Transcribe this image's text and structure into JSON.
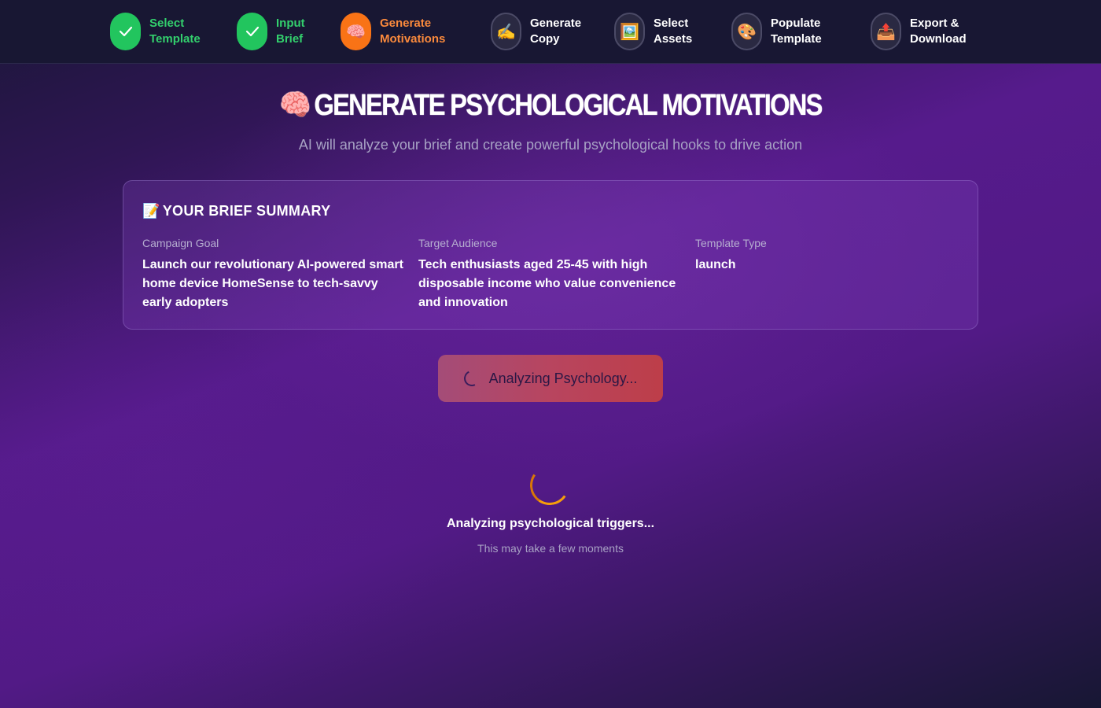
{
  "stepper": {
    "steps": [
      {
        "line1": "Select",
        "line2": "Template",
        "icon": "check-icon",
        "status": "done"
      },
      {
        "line1": "Input",
        "line2": "Brief",
        "icon": "check-icon",
        "status": "done"
      },
      {
        "line1": "Generate",
        "line2": "Motivations",
        "icon": "🧠",
        "status": "active"
      },
      {
        "line1": "Generate",
        "line2": "Copy",
        "icon": "✍️",
        "status": "pending"
      },
      {
        "line1": "Select",
        "line2": "Assets",
        "icon": "🖼️",
        "status": "pending"
      },
      {
        "line1": "Populate",
        "line2": "Template",
        "icon": "🎨",
        "status": "pending"
      },
      {
        "line1": "Export &",
        "line2": "Download",
        "icon": "📤",
        "status": "pending"
      }
    ]
  },
  "header": {
    "icon": "🧠",
    "title": "GENERATE PSYCHOLOGICAL MOTIVATIONS",
    "subtitle": "AI will analyze your brief and create powerful psychological hooks to drive action"
  },
  "brief": {
    "icon": "📝",
    "title": "YOUR BRIEF SUMMARY",
    "fields": [
      {
        "label": "Campaign Goal",
        "value": "Launch our revolutionary AI-powered smart home device HomeSense to tech-savvy early adopters"
      },
      {
        "label": "Target Audience",
        "value": "Tech enthusiasts aged 25-45 with high disposable income who value convenience and innovation"
      },
      {
        "label": "Template Type",
        "value": "launch"
      }
    ]
  },
  "action": {
    "button_label": "Analyzing Psychology..."
  },
  "loader": {
    "title": "Analyzing psychological triggers...",
    "subtitle": "This may take a few moments"
  },
  "colors": {
    "done": "#22c55e",
    "active": "#f97316",
    "pending": "#2a2942",
    "accent_loader": "#f59e0b"
  }
}
